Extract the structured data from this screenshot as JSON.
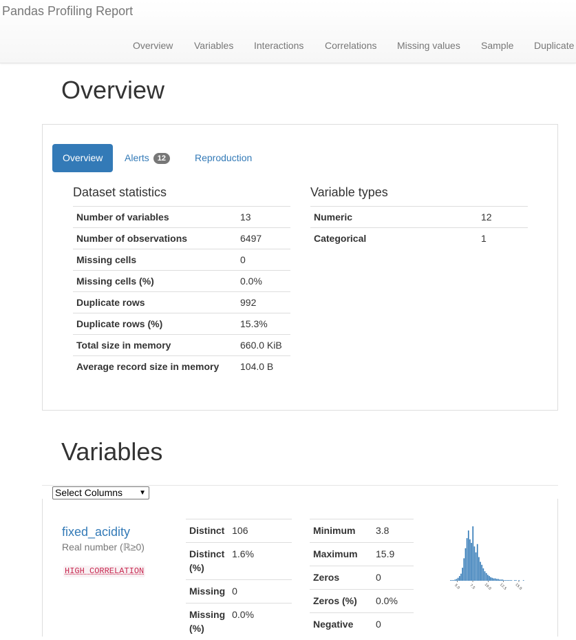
{
  "app": {
    "title": "Pandas Profiling Report"
  },
  "nav": [
    "Overview",
    "Variables",
    "Interactions",
    "Correlations",
    "Missing values",
    "Sample",
    "Duplicate"
  ],
  "overview": {
    "heading": "Overview",
    "tabs": {
      "overview": "Overview",
      "alerts": "Alerts",
      "alerts_count": "12",
      "reproduction": "Reproduction"
    },
    "dataset_statistics": {
      "title": "Dataset statistics",
      "rows": [
        {
          "key": "Number of variables",
          "value": "13"
        },
        {
          "key": "Number of observations",
          "value": "6497"
        },
        {
          "key": "Missing cells",
          "value": "0"
        },
        {
          "key": "Missing cells (%)",
          "value": "0.0%"
        },
        {
          "key": "Duplicate rows",
          "value": "992"
        },
        {
          "key": "Duplicate rows (%)",
          "value": "15.3%"
        },
        {
          "key": "Total size in memory",
          "value": "660.0 KiB"
        },
        {
          "key": "Average record size in memory",
          "value": "104.0 B"
        }
      ]
    },
    "variable_types": {
      "title": "Variable types",
      "rows": [
        {
          "key": "Numeric",
          "value": "12"
        },
        {
          "key": "Categorical",
          "value": "1"
        }
      ]
    }
  },
  "variables": {
    "heading": "Variables",
    "select": {
      "label": "Select Columns"
    },
    "variable": {
      "name": "fixed_acidity",
      "type": "Real number (ℝ≥0)",
      "tag": "HIGH CORRELATION",
      "stats_left": [
        {
          "key": "Distinct",
          "value": "106"
        },
        {
          "key": "Distinct (%)",
          "value": "1.6%"
        },
        {
          "key": "Missing",
          "value": "0"
        },
        {
          "key": "Missing (%)",
          "value": "0.0%"
        }
      ],
      "stats_right": [
        {
          "key": "Minimum",
          "value": "3.8"
        },
        {
          "key": "Maximum",
          "value": "15.9"
        },
        {
          "key": "Zeros",
          "value": "0"
        },
        {
          "key": "Zeros (%)",
          "value": "0.0%"
        },
        {
          "key": "Negative",
          "value": "0"
        }
      ]
    }
  },
  "colors": {
    "accent": "#337ab7",
    "tag_text": "#c7254e",
    "bar": "#337ab7"
  },
  "chart_data": {
    "type": "bar",
    "x_ticks": [
      "5.0",
      "7.5",
      "10.0",
      "12.5",
      "15.0"
    ],
    "xlim": [
      3.8,
      15.9
    ],
    "values": [
      1,
      1,
      1,
      2,
      3,
      5,
      8,
      12,
      22,
      38,
      55,
      72,
      85,
      70,
      64,
      92,
      58,
      48,
      62,
      40,
      32,
      27,
      21,
      16,
      13,
      10,
      8,
      6,
      5,
      4,
      4,
      3,
      3,
      2,
      2,
      2,
      1,
      1,
      1,
      1,
      1,
      1,
      0,
      1,
      1,
      0,
      1,
      0,
      0,
      1
    ]
  }
}
